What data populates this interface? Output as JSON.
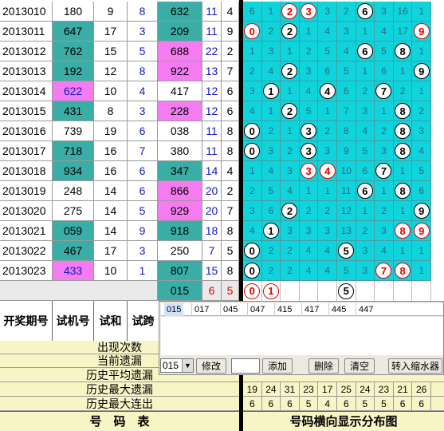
{
  "table": {
    "rows": [
      {
        "period": "2013010",
        "num": "180",
        "he": "9",
        "kua": "8",
        "trial": "632",
        "a": "11",
        "b": "4",
        "numHi": false,
        "trialHi": "teal"
      },
      {
        "period": "2013011",
        "num": "647",
        "he": "17",
        "kua": "3",
        "trial": "209",
        "a": "11",
        "b": "9",
        "numHi": "teal",
        "trialHi": "teal"
      },
      {
        "period": "2013012",
        "num": "762",
        "he": "15",
        "kua": "5",
        "trial": "688",
        "a": "22",
        "b": "2",
        "numHi": "teal",
        "trialHi": "pink"
      },
      {
        "period": "2013013",
        "num": "192",
        "he": "12",
        "kua": "8",
        "trial": "922",
        "a": "13",
        "b": "7",
        "numHi": "teal",
        "trialHi": "pink"
      },
      {
        "period": "2013014",
        "num": "622",
        "he": "10",
        "kua": "4",
        "trial": "417",
        "a": "12",
        "b": "6",
        "numHi": "pink",
        "trialHi": false
      },
      {
        "period": "2013015",
        "num": "431",
        "he": "8",
        "kua": "3",
        "trial": "228",
        "a": "12",
        "b": "6",
        "numHi": "teal",
        "trialHi": "pink"
      },
      {
        "period": "2013016",
        "num": "739",
        "he": "19",
        "kua": "6",
        "trial": "038",
        "a": "11",
        "b": "8",
        "numHi": false,
        "trialHi": false
      },
      {
        "period": "2013017",
        "num": "718",
        "he": "16",
        "kua": "7",
        "trial": "380",
        "a": "11",
        "b": "8",
        "numHi": "teal",
        "trialHi": false
      },
      {
        "period": "2013018",
        "num": "934",
        "he": "16",
        "kua": "6",
        "trial": "347",
        "a": "14",
        "b": "4",
        "numHi": "teal",
        "trialHi": "teal"
      },
      {
        "period": "2013019",
        "num": "248",
        "he": "14",
        "kua": "6",
        "trial": "866",
        "a": "20",
        "b": "2",
        "numHi": false,
        "trialHi": "pink"
      },
      {
        "period": "2013020",
        "num": "275",
        "he": "14",
        "kua": "5",
        "trial": "929",
        "a": "20",
        "b": "7",
        "numHi": false,
        "trialHi": "pink"
      },
      {
        "period": "2013021",
        "num": "059",
        "he": "14",
        "kua": "9",
        "trial": "918",
        "a": "18",
        "b": "8",
        "numHi": "teal",
        "trialHi": "teal"
      },
      {
        "period": "2013022",
        "num": "467",
        "he": "17",
        "kua": "3",
        "trial": "250",
        "a": "7",
        "b": "5",
        "numHi": "teal",
        "trialHi": false
      },
      {
        "period": "2013023",
        "num": "433",
        "he": "10",
        "kua": "1",
        "trial": "807",
        "a": "15",
        "b": "8",
        "numHi": "pink",
        "trialHi": "teal"
      }
    ],
    "pending": {
      "trial": "015",
      "a": "6",
      "b": "5"
    }
  },
  "distribution": {
    "rows": [
      {
        "v": [
          "6",
          "1",
          "2",
          "3",
          "3",
          "2",
          "6",
          "3",
          "16",
          "1"
        ],
        "c": [
          2,
          3,
          6
        ],
        "r": [
          2,
          3
        ]
      },
      {
        "v": [
          "0",
          "2",
          "2",
          "1",
          "4",
          "3",
          "1",
          "4",
          "17",
          "9"
        ],
        "c": [
          0,
          2,
          9
        ],
        "r": [
          0,
          9
        ]
      },
      {
        "v": [
          "1",
          "3",
          "1",
          "2",
          "5",
          "4",
          "6",
          "5",
          "8",
          "1"
        ],
        "c": [
          6,
          8
        ],
        "r": []
      },
      {
        "v": [
          "2",
          "4",
          "2",
          "3",
          "6",
          "5",
          "1",
          "6",
          "1",
          "9"
        ],
        "c": [
          2,
          9
        ],
        "r": []
      },
      {
        "v": [
          "3",
          "1",
          "1",
          "4",
          "4",
          "6",
          "2",
          "7",
          "2",
          "1"
        ],
        "c": [
          1,
          4,
          7
        ],
        "r": []
      },
      {
        "v": [
          "4",
          "1",
          "2",
          "5",
          "1",
          "7",
          "3",
          "1",
          "8",
          "2"
        ],
        "c": [
          2,
          8
        ],
        "r": []
      },
      {
        "v": [
          "0",
          "2",
          "1",
          "3",
          "2",
          "8",
          "4",
          "2",
          "8",
          "3"
        ],
        "c": [
          0,
          3,
          8
        ],
        "r": []
      },
      {
        "v": [
          "0",
          "3",
          "2",
          "3",
          "3",
          "9",
          "5",
          "3",
          "8",
          "4"
        ],
        "c": [
          0,
          3,
          8
        ],
        "r": []
      },
      {
        "v": [
          "1",
          "4",
          "3",
          "3",
          "4",
          "10",
          "6",
          "7",
          "1",
          "5"
        ],
        "c": [
          3,
          4,
          7
        ],
        "r": [
          3,
          4
        ]
      },
      {
        "v": [
          "2",
          "5",
          "4",
          "1",
          "1",
          "11",
          "6",
          "1",
          "8",
          "6"
        ],
        "c": [
          6,
          8
        ],
        "r": []
      },
      {
        "v": [
          "3",
          "6",
          "2",
          "2",
          "2",
          "12",
          "1",
          "2",
          "1",
          "9"
        ],
        "c": [
          2,
          9
        ],
        "r": []
      },
      {
        "v": [
          "4",
          "1",
          "3",
          "3",
          "3",
          "13",
          "2",
          "3",
          "8",
          "9"
        ],
        "c": [
          1,
          8,
          9
        ],
        "r": [
          8,
          9
        ]
      },
      {
        "v": [
          "0",
          "2",
          "2",
          "4",
          "4",
          "5",
          "3",
          "4",
          "1",
          "1"
        ],
        "c": [
          0,
          5
        ],
        "r": []
      },
      {
        "v": [
          "0",
          "2",
          "2",
          "4",
          "4",
          "5",
          "3",
          "7",
          "8",
          "1"
        ],
        "c": [
          0,
          7,
          8
        ],
        "r": [
          7,
          8
        ]
      }
    ],
    "pending": {
      "c": [
        0,
        1,
        5
      ],
      "r": [
        0,
        1
      ]
    }
  },
  "header": {
    "col_period": "开奖期号",
    "col_num": "试机号",
    "col_he": "试和",
    "col_kua": "试跨"
  },
  "stats": {
    "appear_count": "出现次数",
    "current_miss": "当前遗漏",
    "avg_miss": "历史平均遗漏",
    "max_miss": "历史最大遗漏",
    "max_streak": "历史最大连出",
    "max_miss_values": [
      "19",
      "24",
      "31",
      "23",
      "17",
      "25",
      "24",
      "23",
      "21",
      "26"
    ],
    "max_streak_values": [
      "6",
      "6",
      "6",
      "5",
      "4",
      "6",
      "5",
      "5",
      "6",
      "6"
    ]
  },
  "footer": {
    "left": "号　码　表",
    "right": "号码横向显示分布图"
  },
  "panel": {
    "tabs": [
      "015",
      "017",
      "045",
      "047",
      "415",
      "417",
      "445",
      "447"
    ],
    "select_value": "015",
    "btn_modify": "修改",
    "btn_add": "添加",
    "btn_delete": "删除",
    "btn_clear": "清空",
    "btn_transfer": "转入缩水器"
  }
}
